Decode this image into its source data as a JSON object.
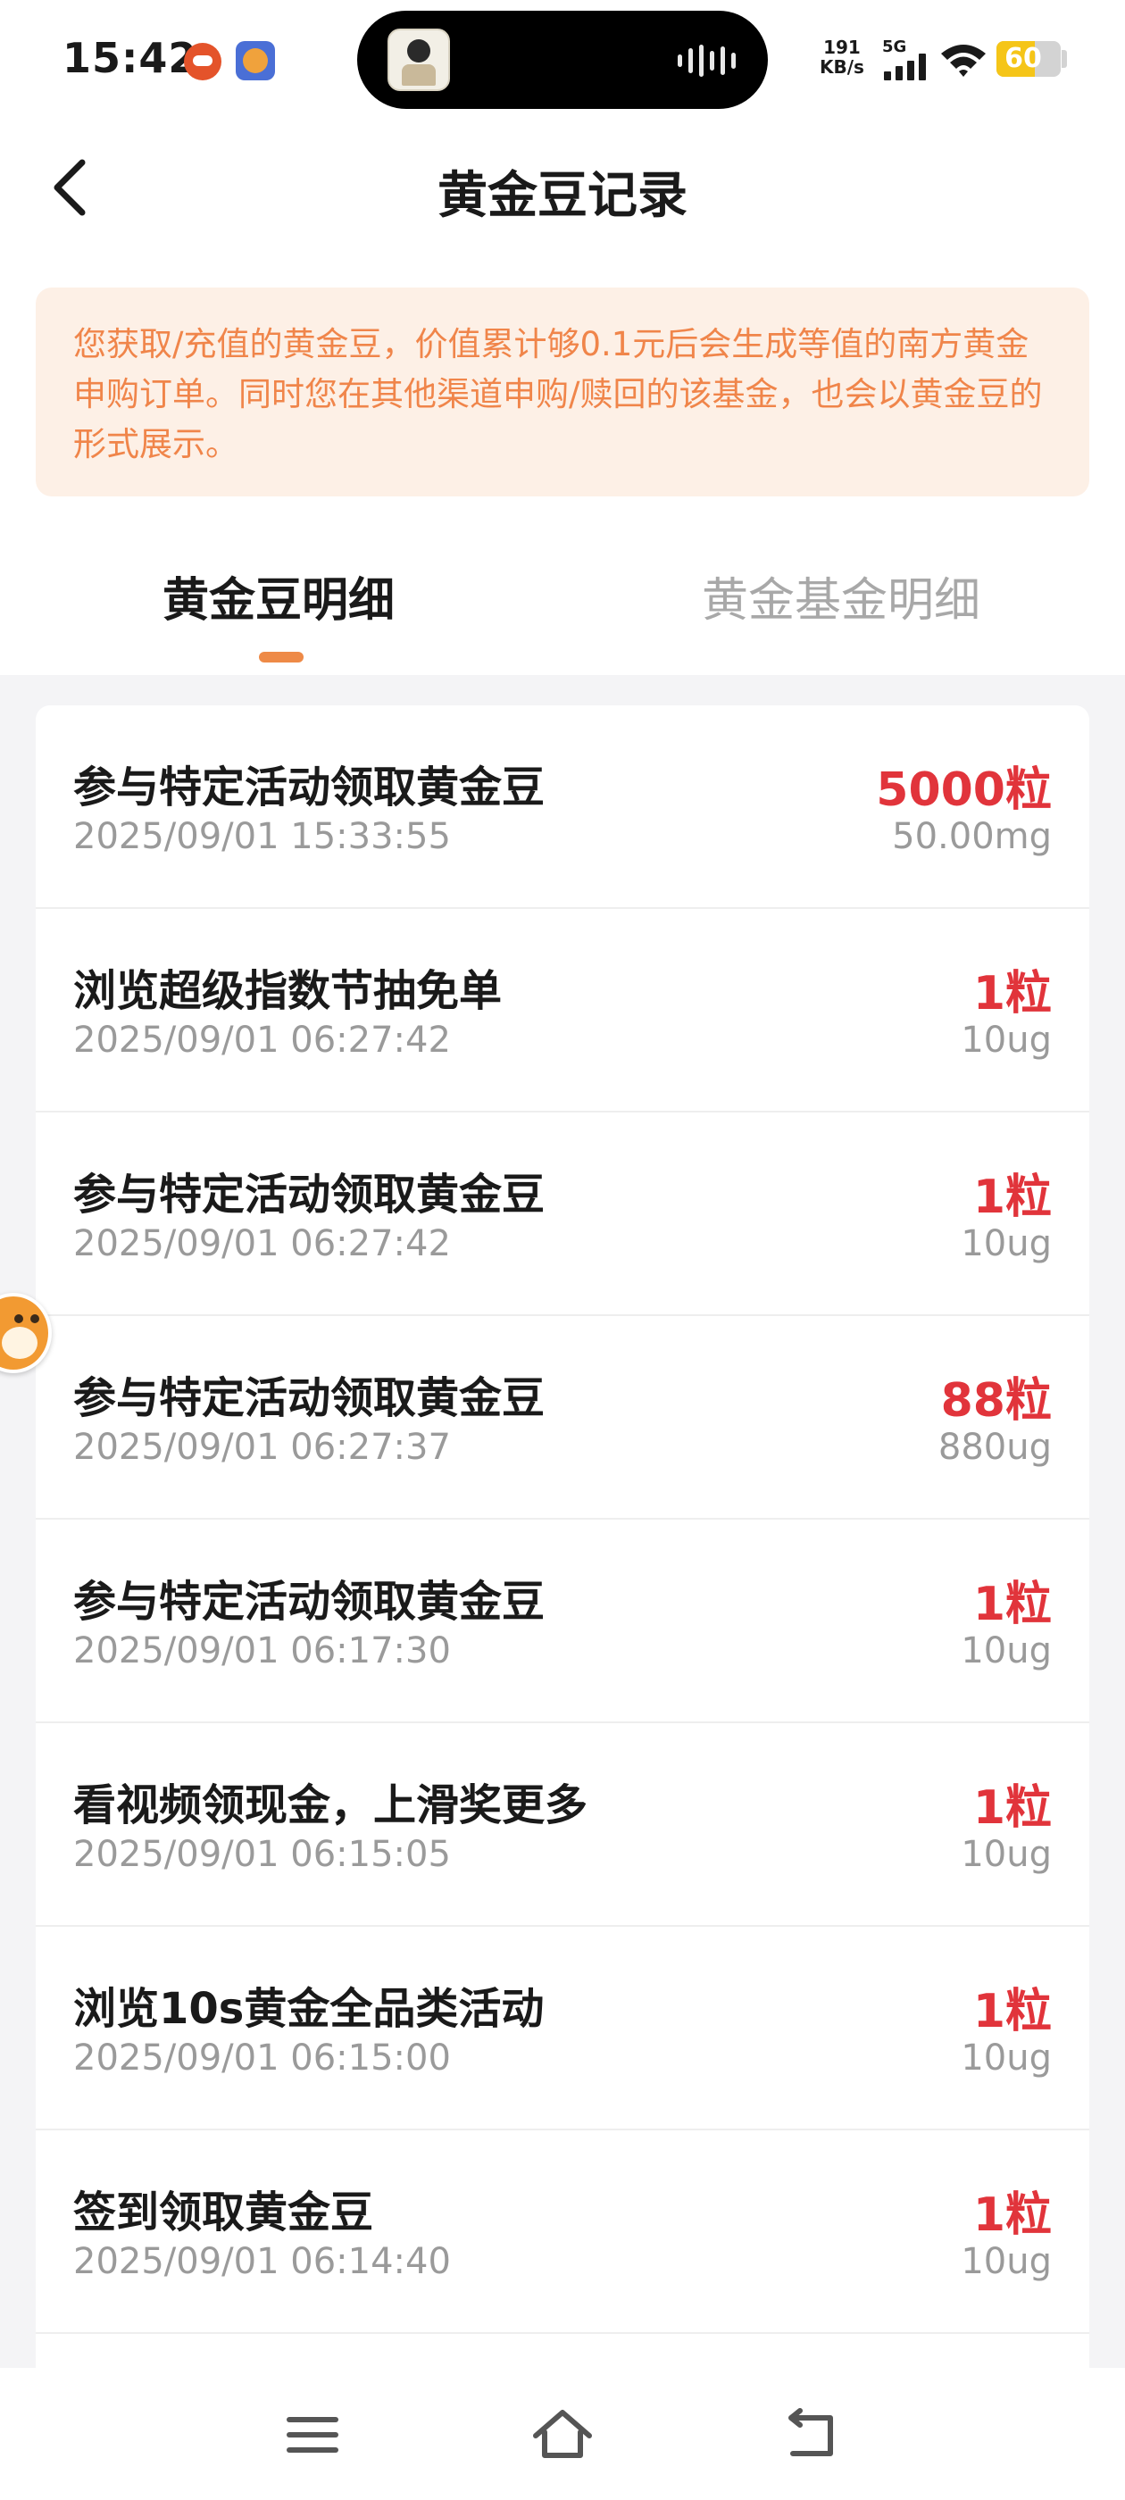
{
  "status_bar": {
    "time": "15:42",
    "net_speed_value": "191",
    "net_speed_unit": "KB/s",
    "network": "5G",
    "battery": "60",
    "battery_level": 0.6
  },
  "header": {
    "title": "黄金豆记录"
  },
  "notice": {
    "text": "您获取/充值的黄金豆，价值累计够0.1元后会生成等值的南方黄金申购订单。同时您在其他渠道申购/赎回的该基金，也会以黄金豆的形式展示。"
  },
  "tabs": [
    {
      "label": "黄金豆明细",
      "active": true
    },
    {
      "label": "黄金基金明细",
      "active": false
    }
  ],
  "records": [
    {
      "title": "参与特定活动领取黄金豆",
      "time": "2025/09/01 15:33:55",
      "amount": "5000粒",
      "weight": "50.00mg"
    },
    {
      "title": "浏览超级指数节抽免单",
      "time": "2025/09/01 06:27:42",
      "amount": "1粒",
      "weight": "10ug"
    },
    {
      "title": "参与特定活动领取黄金豆",
      "time": "2025/09/01 06:27:42",
      "amount": "1粒",
      "weight": "10ug"
    },
    {
      "title": "参与特定活动领取黄金豆",
      "time": "2025/09/01 06:27:37",
      "amount": "88粒",
      "weight": "880ug"
    },
    {
      "title": "参与特定活动领取黄金豆",
      "time": "2025/09/01 06:17:30",
      "amount": "1粒",
      "weight": "10ug"
    },
    {
      "title": "看视频领现金，上滑奖更多",
      "time": "2025/09/01 06:15:05",
      "amount": "1粒",
      "weight": "10ug"
    },
    {
      "title": "浏览10s黄金全品类活动",
      "time": "2025/09/01 06:15:00",
      "amount": "1粒",
      "weight": "10ug"
    },
    {
      "title": "签到领取黄金豆",
      "time": "2025/09/01 06:14:40",
      "amount": "1粒",
      "weight": "10ug"
    }
  ],
  "colors": {
    "amount": "#e1343b",
    "notice_text": "#f0854a",
    "notice_bg": "#fdf0e6",
    "tab_indicator": "#ee8a47"
  },
  "icons": {
    "back": "chevron-left-icon",
    "nav_menu": "menu-icon",
    "nav_home": "home-icon",
    "nav_back": "return-icon"
  }
}
